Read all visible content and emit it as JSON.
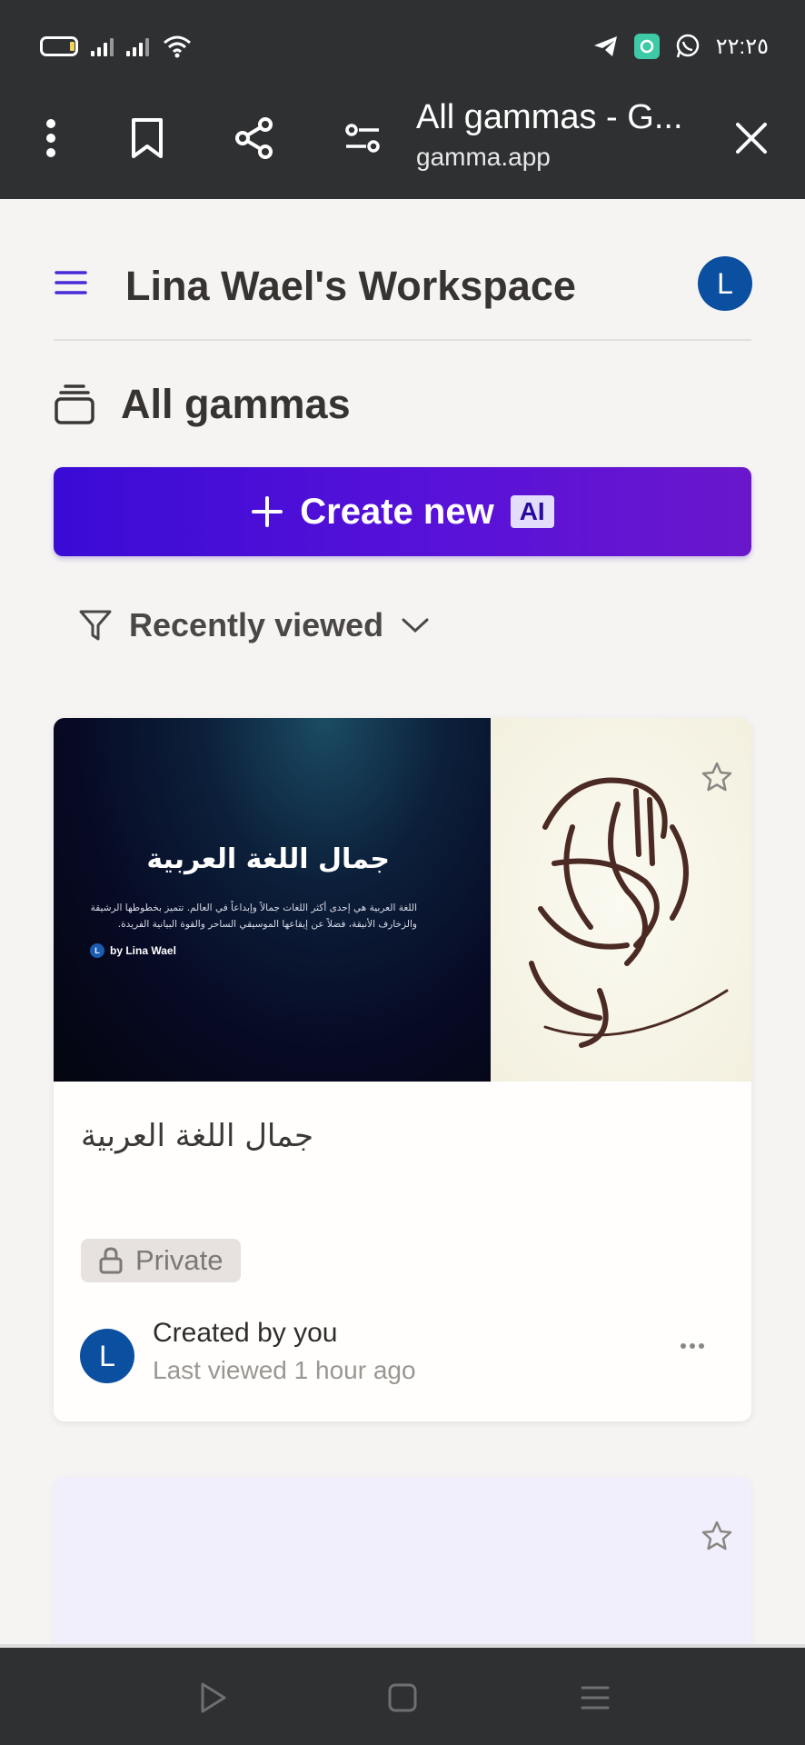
{
  "status_bar": {
    "time": "٢٢:٢٥",
    "icons": [
      "battery-icon",
      "signal-icon",
      "signal-icon",
      "wifi-icon",
      "telegram-icon",
      "app-notification-icon",
      "whatsapp-icon"
    ]
  },
  "browser": {
    "title": "All gammas - G...",
    "domain": "gamma.app",
    "icons": [
      "more-vert-icon",
      "bookmark-icon",
      "share-icon",
      "settings-sliders-icon",
      "close-icon"
    ]
  },
  "workspace": {
    "title": "Lina Wael's Workspace",
    "avatar_letter": "L"
  },
  "section": {
    "title": "All gammas"
  },
  "create_button": {
    "plus": "+",
    "label": "Create new",
    "badge": "AI"
  },
  "filter": {
    "label": "Recently viewed"
  },
  "card": {
    "thumbnail": {
      "title": "جمال اللغة العربية",
      "description": "اللغة العربية هي إحدى أكثر اللغات جمالاً وإبداعاً في العالم. تتميز بخطوطها الرشيقة والزخارف الأنيقة، فضلاً عن إيقاعها الموسيقي الساحر والقوة البيانية الفريدة.",
      "byline": "by Lina Wael",
      "avatar_letter": "L"
    },
    "title": "جمال اللغة العربية",
    "badge": "Private",
    "avatar_letter": "L",
    "created": "Created by you",
    "last_viewed": "Last viewed 1 hour ago"
  },
  "colors": {
    "accent": "#3a0bd6",
    "avatar": "#0a4fa0",
    "system_bar": "#2f3032"
  }
}
